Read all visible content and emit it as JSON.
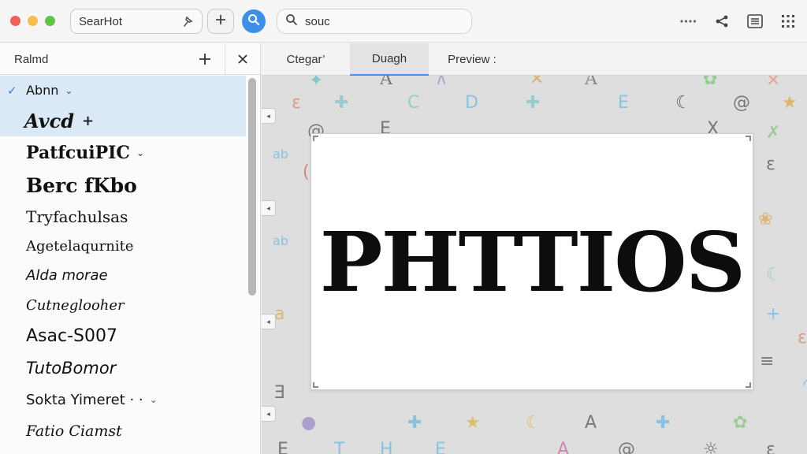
{
  "toolbar": {
    "app_field_label": "SearHot",
    "search_value": "souc",
    "icons": [
      "pin-icon",
      "plus-icon",
      "search-icon",
      "more-icon",
      "share-icon",
      "list-icon",
      "grid-icon"
    ]
  },
  "sidebar": {
    "title": "Ralmd",
    "items": [
      {
        "label": "Abnn",
        "has_check": true,
        "has_chevron": true
      },
      {
        "label": "Avcd",
        "has_plus": true
      },
      {
        "label": "PatfcuiPIC",
        "has_chevron": true
      },
      {
        "label": "Berc fKbo"
      },
      {
        "label": "Tryfachulsas"
      },
      {
        "label": "Agetelaqurnite"
      },
      {
        "label": "Alda morae"
      },
      {
        "label": "Cutneglooher"
      },
      {
        "label": "Asac-S007"
      },
      {
        "label": "TutoBomor"
      },
      {
        "label": "Sokta Yimeret · ·",
        "has_chevron": true
      },
      {
        "label": "Fatio Ciamst"
      }
    ]
  },
  "tabs": [
    {
      "label": "Ctegar’"
    },
    {
      "label": "Duagh"
    },
    {
      "label": "Preview :"
    }
  ],
  "preview": {
    "text": "PHTTIOS"
  },
  "colors": {
    "accent": "#3f8fe6",
    "selection": "#dbe9f7",
    "check": "#2f7fd9"
  }
}
